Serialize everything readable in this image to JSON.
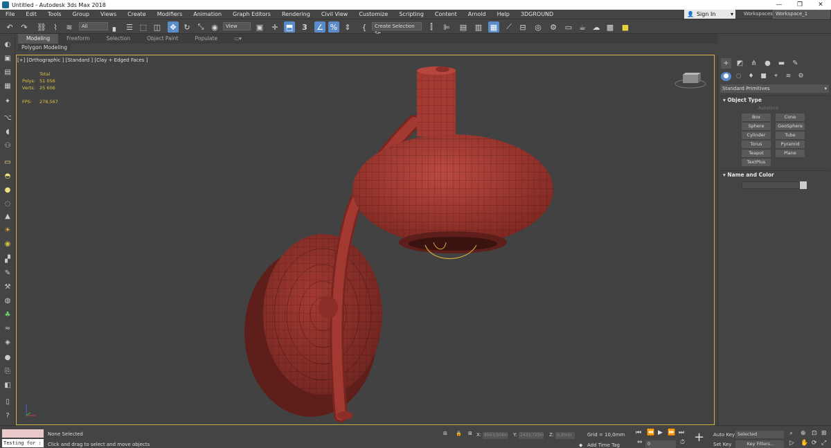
{
  "window": {
    "title": "Untitled - Autodesk 3ds Max 2018",
    "controls": {
      "minimize": "—",
      "maximize": "❐",
      "close": "✕"
    }
  },
  "menu": [
    "File",
    "Edit",
    "Tools",
    "Group",
    "Views",
    "Create",
    "Modifiers",
    "Animation",
    "Graph Editors",
    "Rendering",
    "Civil View",
    "Customize",
    "Scripting",
    "Content",
    "Arnold",
    "Help",
    "3DGROUND"
  ],
  "account": {
    "sign_in": "Sign In",
    "workspaces_label": "Workspaces:",
    "workspace_value": "Workspace_1"
  },
  "toolbar": {
    "selection_filter": "All",
    "reference_coord": "View",
    "snap_toggle_label": "3",
    "named_selection_placeholder": "Create Selection Se"
  },
  "ribbon": {
    "tabs": [
      {
        "label": "Modeling",
        "active": true
      },
      {
        "label": "Freeform",
        "active": false
      },
      {
        "label": "Selection",
        "active": false
      },
      {
        "label": "Object Paint",
        "active": false
      },
      {
        "label": "Populate",
        "active": false
      }
    ],
    "panel_label": "Polygon Modeling"
  },
  "viewport": {
    "label": "[+] [Orthographic ] [Standard ] [Clay + Edged Faces ]",
    "stats": {
      "header": "Total",
      "polys_label": "Polys:",
      "polys_value": "51 056",
      "verts_label": "Verts:",
      "verts_value": "25 606",
      "fps_label": "FPS:",
      "fps_value": "278,567"
    },
    "model_color": "#a33a32",
    "border_color": "#d1b84c"
  },
  "command_panel": {
    "category": "Standard Primitives",
    "object_type_title": "Object Type",
    "autogrid": "AutoGrid",
    "buttons": [
      "Box",
      "Cone",
      "Sphere",
      "GeoSphere",
      "Cylinder",
      "Tube",
      "Torus",
      "Pyramid",
      "Teapot",
      "Plane",
      "TextPlus"
    ],
    "name_and_color_title": "Name and Color"
  },
  "status": {
    "maxscript_text": "Testing for :",
    "selection": "None Selected",
    "prompt": "Click and drag to select and move objects",
    "x_label": "X:",
    "x_value": "8563,504m",
    "y_label": "Y:",
    "y_value": "2433,723m",
    "z_label": "Z:",
    "z_value": "0,0mm",
    "grid": "Grid = 10,0mm",
    "add_time_tag": "Add Time Tag",
    "frame_value": "0",
    "auto_key": "Auto Key",
    "set_key": "Set Key",
    "key_mode": "Selected",
    "key_filters": "Key Filters..."
  }
}
